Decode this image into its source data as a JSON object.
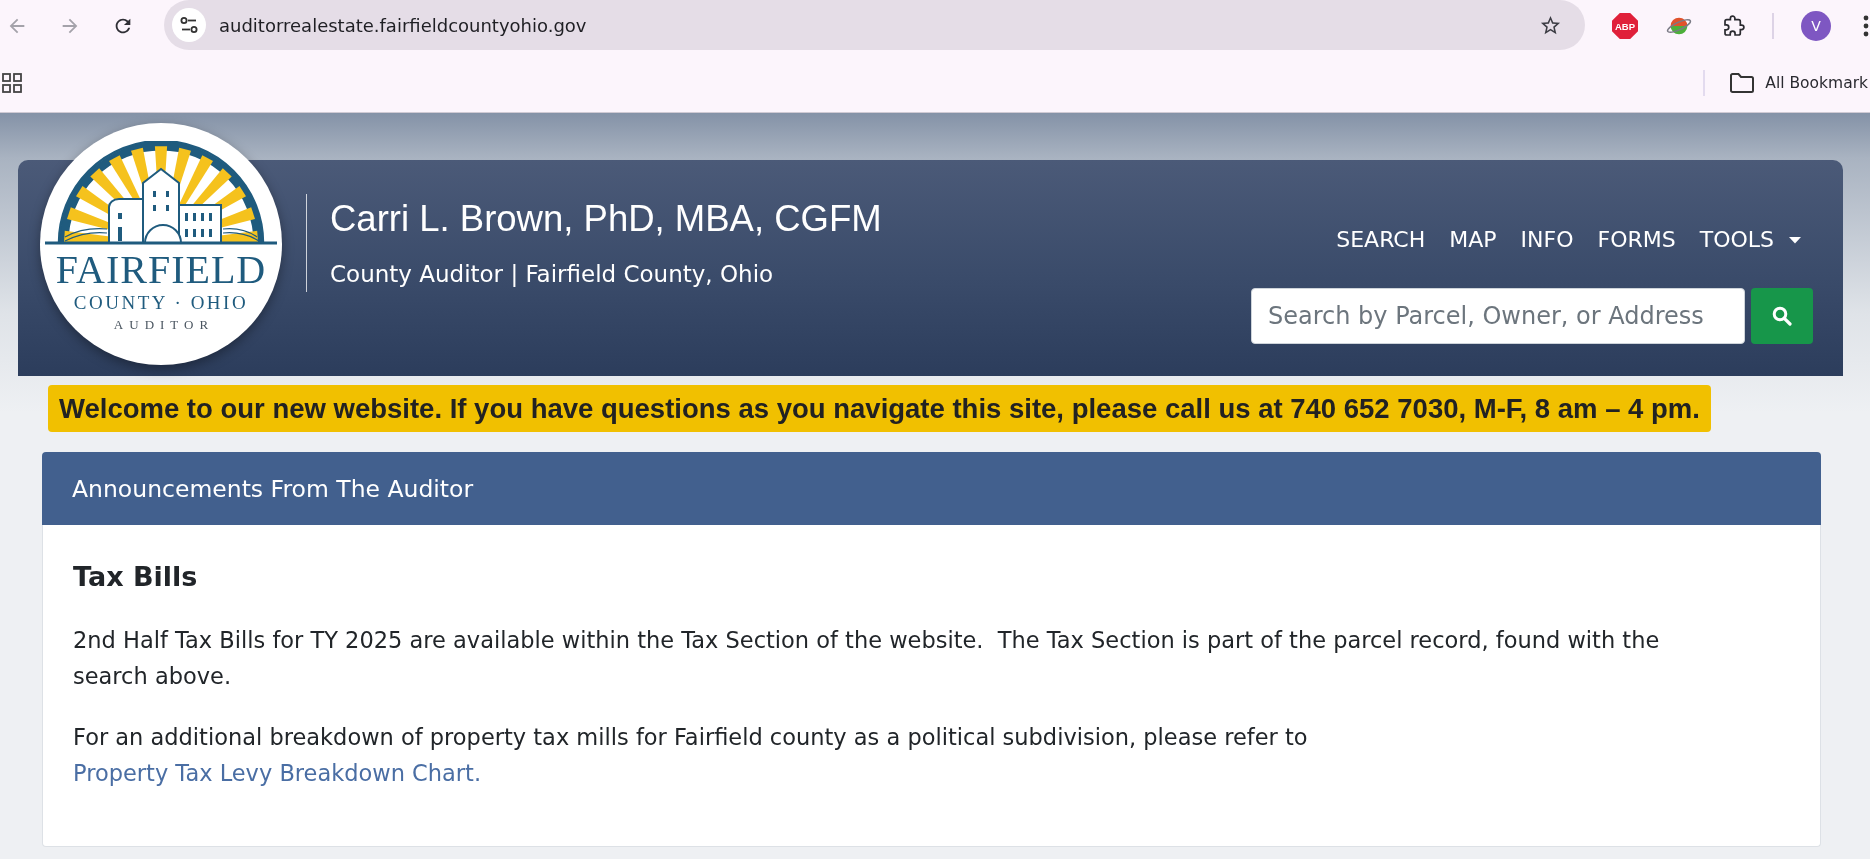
{
  "browser": {
    "nav_buttons": [
      {
        "kind": "back",
        "disabled": true
      },
      {
        "kind": "forward",
        "disabled": true
      },
      {
        "kind": "reload",
        "disabled": false
      }
    ],
    "url": "auditorrealestate.fairfieldcountyohio.gov",
    "bookmarked": false,
    "extensions": [
      {
        "kind": "adblock",
        "label": "ABP"
      },
      {
        "kind": "planet"
      },
      {
        "kind": "puzzle"
      }
    ],
    "profile_initial": "V",
    "all_bookmarks": "All Bookmark"
  },
  "header": {
    "logo": {
      "name": "FAIRFIELD",
      "region": "COUNTY · OHIO",
      "office": "AUDITOR"
    },
    "title": "Carri L. Brown, PhD, MBA, CGFM",
    "subtitle": "County Auditor | Fairfield County, Ohio",
    "nav": [
      {
        "label": "SEARCH",
        "dropdown": false
      },
      {
        "label": "MAP",
        "dropdown": false
      },
      {
        "label": "INFO",
        "dropdown": false
      },
      {
        "label": "FORMS",
        "dropdown": false
      },
      {
        "label": "TOOLS",
        "dropdown": true
      }
    ],
    "search": {
      "placeholder": "Search by Parcel, Owner, or Address"
    }
  },
  "banner": {
    "text": "Welcome to our new website. If you have questions as you navigate this site, please call us at 740 652 7030, M-F, 8 am – 4 pm."
  },
  "announcements": {
    "heading": "Announcements From The Auditor",
    "posts": [
      {
        "title": "Tax Bills",
        "paragraphs": [
          {
            "text": "2nd Half Tax Bills for TY 2025 are available within the Tax Section of the website.  The Tax Section is part of the parcel record, found with the search above."
          },
          {
            "text": "For an additional breakdown of property tax mills for Fairfield county as a political subdivision, please refer to",
            "link": "Property Tax Levy Breakdown Chart."
          }
        ]
      }
    ]
  }
}
